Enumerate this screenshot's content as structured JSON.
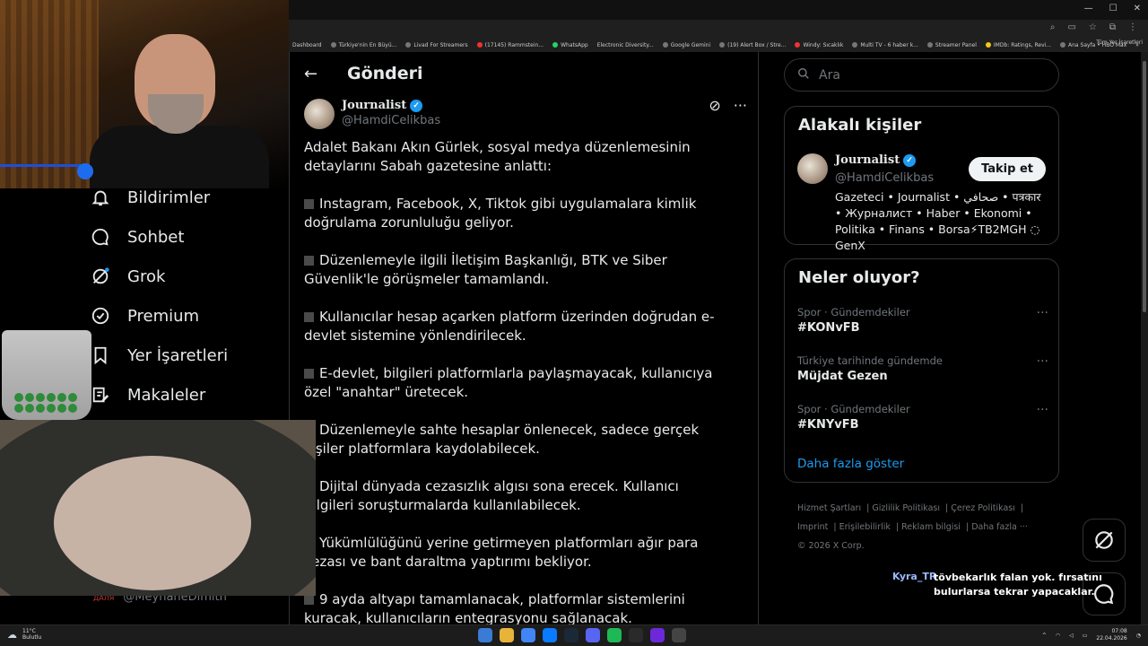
{
  "browser": {
    "bookmarks": [
      "Dashboard",
      "Türkiye'nin En Büyü...",
      "Livad For Streamers",
      "(17145) Rammstein...",
      "WhatsApp",
      "Electronic Diversity...",
      "Google Gemini",
      "(19) Alert Box / Stre...",
      "Windy: Sıcaklık",
      "Multi TV - 6 haber k...",
      "Streamer Panel",
      "IMDb: Ratings, Revi...",
      "Ana Sayfa • HBO Max"
    ],
    "bookmarks_more": "»",
    "all_bookmarks": "Tüm Yer İşaretleri"
  },
  "nav": [
    {
      "label": "Bildirimler",
      "icon": "bell-icon",
      "glyph": "🔔"
    },
    {
      "label": "Sohbet",
      "icon": "chat-bubble-icon",
      "glyph": "◯"
    },
    {
      "label": "Grok",
      "icon": "grok-icon",
      "glyph": "⊘"
    },
    {
      "label": "Premium",
      "icon": "premium-badge-icon",
      "glyph": "✓"
    },
    {
      "label": "Yer İşaretleri",
      "icon": "bookmark-icon",
      "glyph": "🔖"
    },
    {
      "label": "Makaleler",
      "icon": "article-icon",
      "glyph": "✎"
    }
  ],
  "under_handle": {
    "red": "ДАЛЯ",
    "handle": "@MeyhaneDimith"
  },
  "post": {
    "header_title": "Gönderi",
    "author_name": "Journalist",
    "author_handle": "@HamdiCelikbas",
    "intro": "Adalet Bakanı Akın Gürlek, sosyal medya düzenlemesinin detaylarını Sabah gazetesine anlattı:",
    "bullets": [
      "Instagram, Facebook, X, Tiktok gibi uygulamalara kimlik doğrulama zorunluluğu geliyor.",
      "Düzenlemeyle ilgili İletişim Başkanlığı, BTK ve Siber Güvenlik'le görüşmeler tamamlandı.",
      "Kullanıcılar hesap açarken platform üzerinden doğrudan e-devlet sistemine yönlendirilecek.",
      "E-devlet, bilgileri platformlarla paylaşmayacak, kullanıcıya özel \"anahtar\" üretecek.",
      "Düzenlemeyle sahte hesaplar önlenecek, sadece gerçek kişiler platformlara kaydolabilecek.",
      "Dijital dünyada cezasızlık algısı sona erecek. Kullanıcı bilgileri soruşturmalarda kullanılabilecek.",
      "Yükümlülüğünü yerine getirmeyen platformları ağır para cezası ve bant daraltma yaptırımı bekliyor.",
      "9 ayda altyapı tamamlanacak, platformlar sistemlerini kuracak, kullanıcıların entegrasyonu sağlanacak."
    ]
  },
  "search": {
    "placeholder": "Ara"
  },
  "related": {
    "title": "Alakalı kişiler",
    "name": "Journalist",
    "handle": "@HamdiCelikbas",
    "follow_label": "Takip et",
    "bio": "Gazeteci • Journalist • صحافي • पत्रकार • Журналист • Haber • Ekonomi • Politika • Finans • Borsa⚡TB2MGH ◌ GenX"
  },
  "trends": {
    "title": "Neler oluyor?",
    "items": [
      {
        "category": "Spor · Gündemdekiler",
        "name": "#KONvFB"
      },
      {
        "category": "Türkiye tarihinde gündemde",
        "name": "Müjdat Gezen"
      },
      {
        "category": "Spor · Gündemdekiler",
        "name": "#KNYvFB"
      }
    ],
    "more_glyph": "···",
    "show_more": "Daha fazla göster"
  },
  "footer": {
    "links": [
      "Hizmet Şartları",
      "Gizlilik Politikası",
      "Çerez Politikası",
      "Imprint",
      "Erişilebilirlik",
      "Reklam bilgisi",
      "Daha fazla ···"
    ],
    "copyright": "© 2026 X Corp."
  },
  "chat": {
    "user": "Kyra_TR",
    "message": "tövbekarlık falan yok. fırsatını bulurlarsa tekrar yapacaklar."
  },
  "taskbar": {
    "temp": "11°C",
    "weather": "Bulutlu",
    "time": "07:08",
    "date": "22.04.2026",
    "app_colors": [
      "#3a7bd5",
      "#e8b339",
      "#4285f4",
      "#0a7aff",
      "#1b2838",
      "#5865f2",
      "#1db954",
      "#2a2a2a",
      "#6d28d9",
      "#444"
    ]
  }
}
